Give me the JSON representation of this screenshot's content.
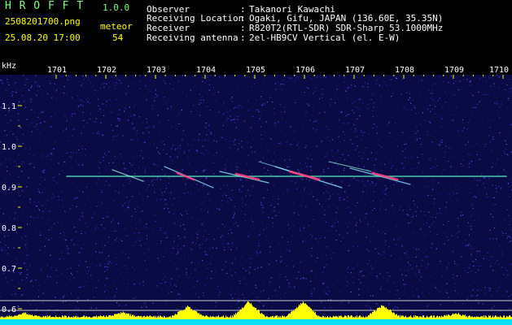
{
  "app": {
    "name": "H R O F F T",
    "version": "1.0.0"
  },
  "file": {
    "name": "2508201700.png",
    "datetime": "25.08.20 17:00"
  },
  "meteor": {
    "label": "meteor",
    "count": "54"
  },
  "info": [
    {
      "key": "Observer",
      "sep": ":",
      "value": "Takanori Kawachi"
    },
    {
      "key": "Receiving Location",
      "sep": ":",
      "value": "Ogaki, Gifu, JAPAN (136.60E, 35.35N)"
    },
    {
      "key": "Receiver",
      "sep": ":",
      "value": "R820T2(RTL-SDR) SDR-Sharp 53.1000MHz"
    },
    {
      "key": "Receiving antenna",
      "sep": ":",
      "value": "2el-HB9CV Vertical (el. E-W)"
    }
  ],
  "axis": {
    "unit": "kHz",
    "time_ticks": [
      "1701",
      "1702",
      "1703",
      "1704",
      "1705",
      "1706",
      "1707",
      "1708",
      "1709",
      "1710"
    ],
    "freq_ticks": [
      "1.1",
      "1.0",
      "0.9",
      "0.8",
      "0.7",
      "0.6"
    ]
  },
  "colors": {
    "background": "#000000",
    "plot_bg": "#0a0a44",
    "axis_tick": "#ffff00",
    "beacon_line": "#50f0c0",
    "meteor_echo": "#ff4080",
    "level_bars": "#ffff00",
    "baseline": "#00e0ff"
  }
}
